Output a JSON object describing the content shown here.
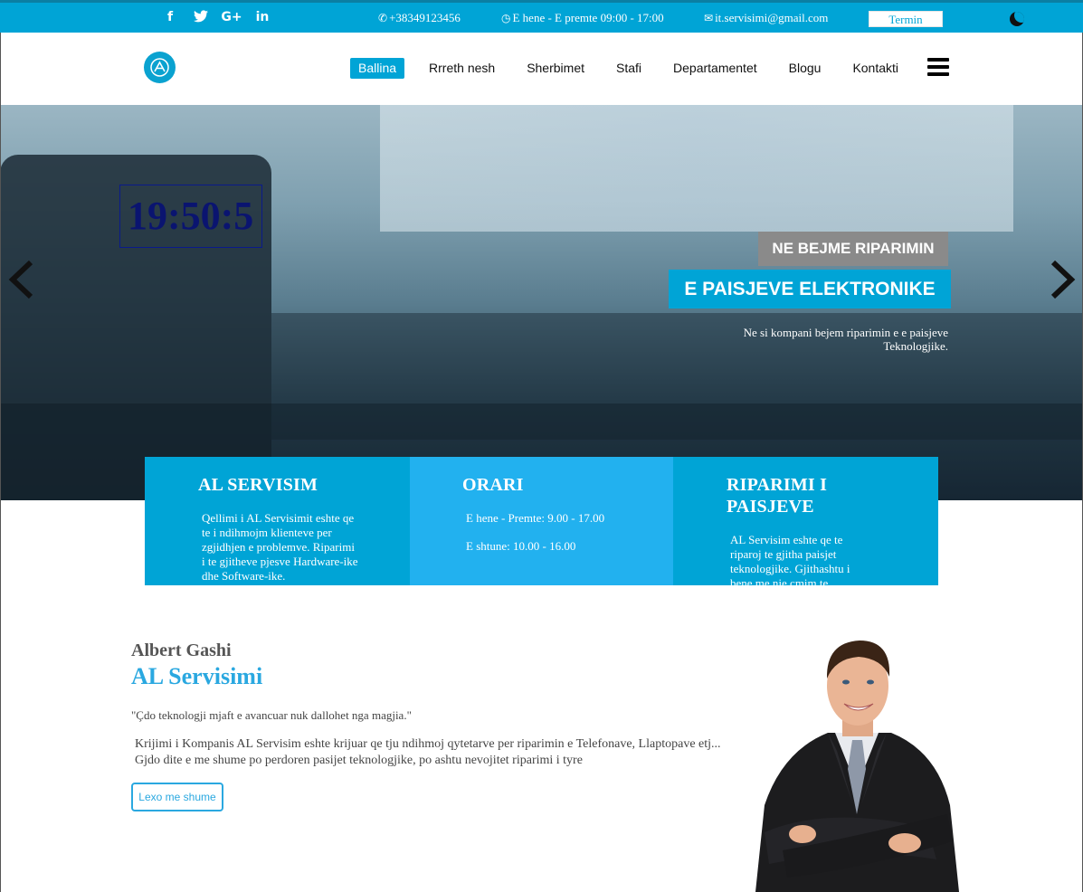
{
  "topbar": {
    "social_icons": [
      "facebook-icon",
      "twitter-icon",
      "google-plus-icon",
      "linkedin-icon"
    ],
    "social_glyphs": [
      "f",
      "𝕥",
      "G+",
      "in"
    ],
    "phone": "+38349123456",
    "hours": "E hene - E premte 09:00 - 17:00",
    "email": "it.servisimi@gmail.com",
    "termin_label": "Termin"
  },
  "nav": {
    "items": [
      "Ballina",
      "Rrreth nesh",
      "Sherbimet",
      "Stafi",
      "Departamentet",
      "Blogu",
      "Kontakti"
    ],
    "active": "Ballina"
  },
  "hero": {
    "clock": "19:50:5",
    "caption_top": "NE BEJME RIPARIMIN",
    "caption_main": "E PAISJEVE ELEKTRONIKE",
    "caption_sub": "Ne si kompani bejem riparimin e e paisjeve Teknologjike."
  },
  "features": [
    {
      "title": "AL SERVISIM",
      "text": "Qellimi i AL Servisimit eshte qe te i ndihmojm klienteve per zgjidhjen e problemve. Riparimi i te gjitheve pjesve Hardware-ike dhe Software-ike."
    },
    {
      "title": "ORARI",
      "line1": "E hene - Premte: 9.00 - 17.00",
      "line2": "E shtune: 10.00 - 16.00"
    },
    {
      "title": "RIPARIMI I PAISJEVE",
      "text": "AL Servisim eshte qe te riparoj te gjitha paisjet teknologjike. Gjithashtu i bene me nje cmim te"
    }
  ],
  "about": {
    "name": "Albert Gashi",
    "title": "AL Servisimi",
    "quote": "\"Çdo teknologji mjaft e avancuar nuk dallohet nga magjia.\"",
    "text": "Krijimi i Kompanis AL Servisim eshte krijuar qe tju ndihmoj qytetarve per riparimin e Telefonave, Llaptopave etj... Gjdo dite e me shume po perdoren pasijet teknologjike, po ashtu nevojitet riparimi i tyre",
    "button": "Lexo me shume"
  },
  "colors": {
    "accent": "#00a4d6",
    "accent_light": "#22b1ef",
    "caption_gray": "#8a8a8a"
  }
}
